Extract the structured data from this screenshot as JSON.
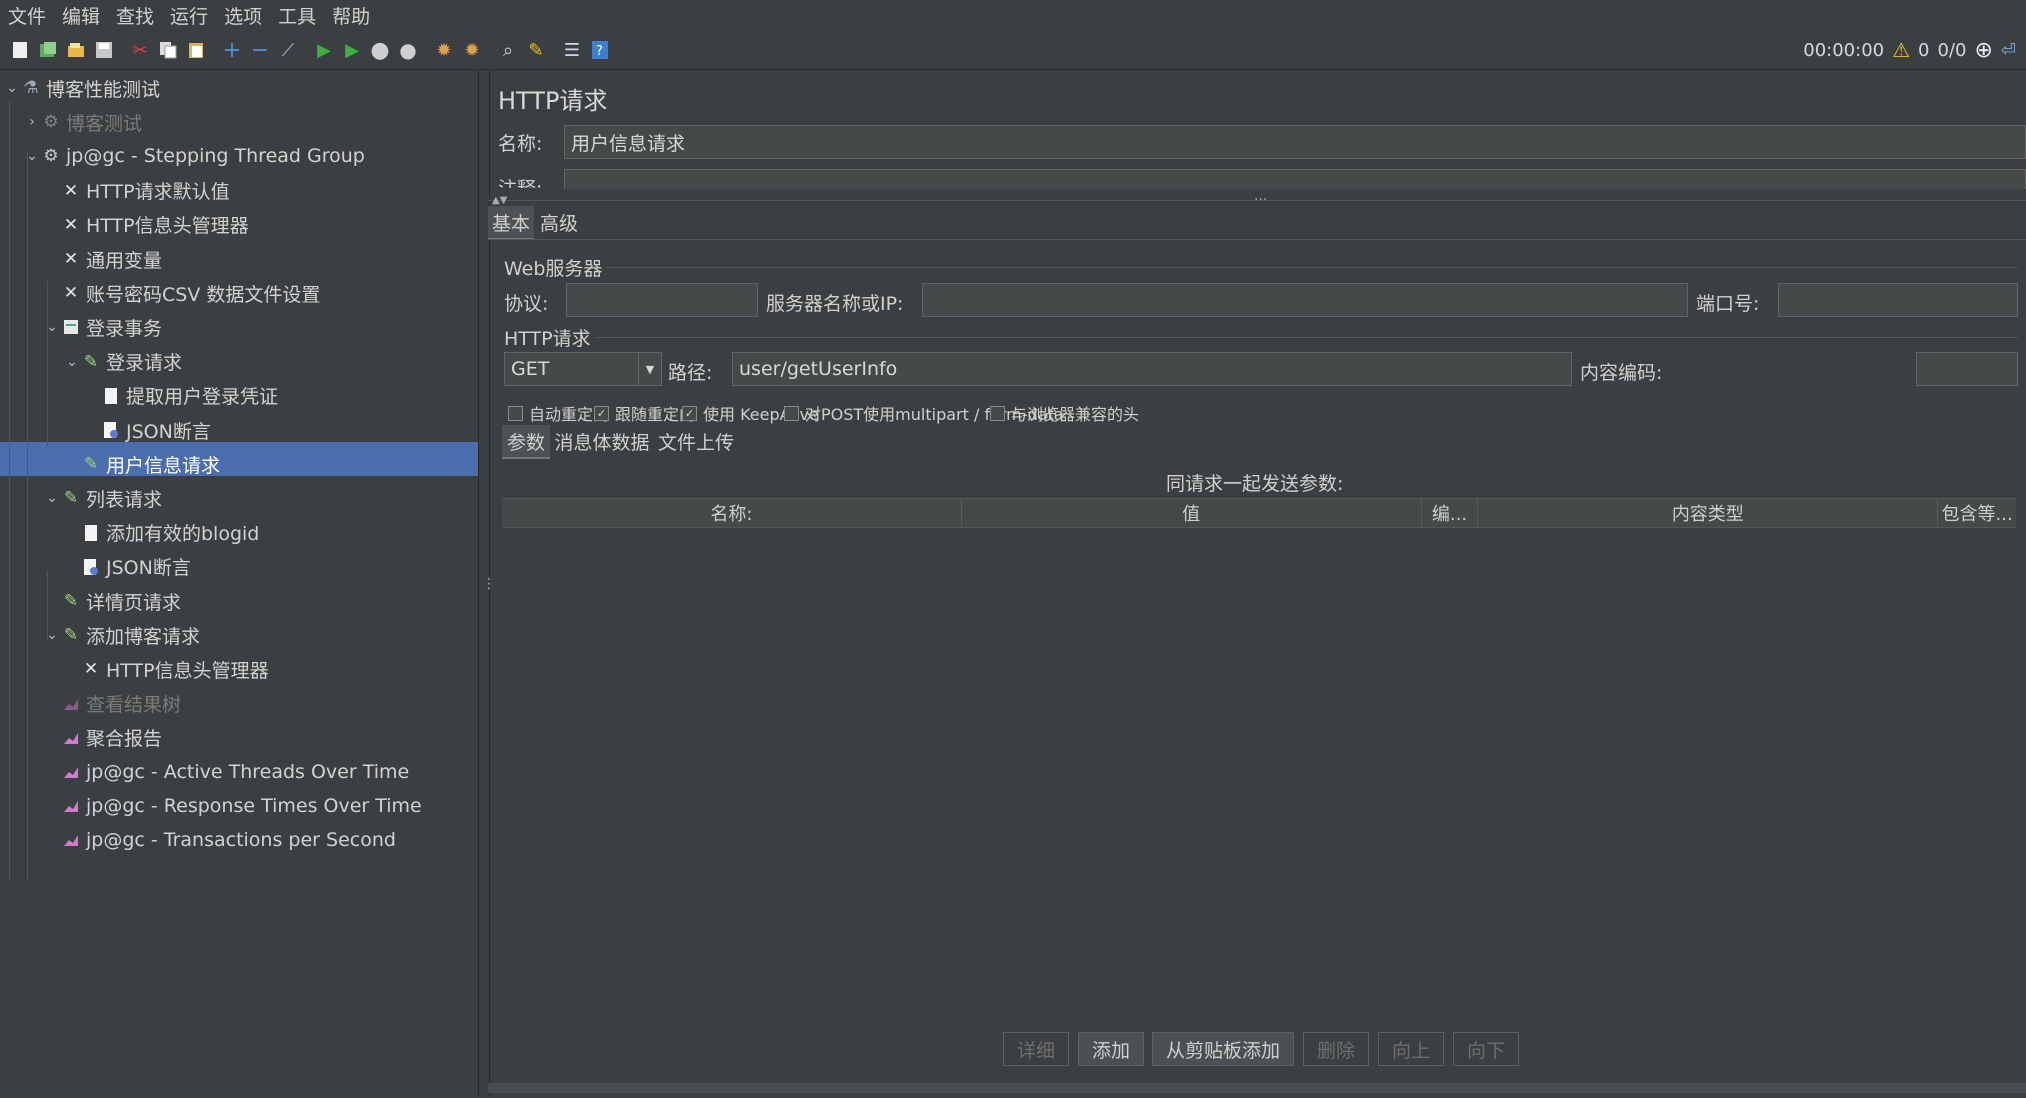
{
  "menu": [
    "文件",
    "编辑",
    "查找",
    "运行",
    "选项",
    "工具",
    "帮助"
  ],
  "toolbar": {
    "timer": "00:00:00",
    "warnings": "0",
    "threads": "0/0"
  },
  "tree": [
    {
      "label": "博客性能测试",
      "icon": "flask-icon",
      "level": 0,
      "expanded": true,
      "disabled": false
    },
    {
      "label": "博客测试",
      "icon": "gear-icon",
      "level": 1,
      "expanded": false,
      "disabled": true
    },
    {
      "label": "jp@gc - Stepping Thread Group",
      "icon": "gear-icon",
      "level": 1,
      "expanded": true,
      "disabled": false
    },
    {
      "label": "HTTP请求默认值",
      "icon": "wrench-icon",
      "level": 2,
      "disabled": false
    },
    {
      "label": "HTTP信息头管理器",
      "icon": "wrench-icon",
      "level": 2,
      "disabled": false
    },
    {
      "label": "通用变量",
      "icon": "wrench-icon",
      "level": 2,
      "disabled": false
    },
    {
      "label": "账号密码CSV 数据文件设置",
      "icon": "wrench-icon",
      "level": 2,
      "disabled": false
    },
    {
      "label": "登录事务",
      "icon": "transaction-icon",
      "level": 2,
      "expanded": true,
      "disabled": false
    },
    {
      "label": "登录请求",
      "icon": "pen-icon",
      "level": 3,
      "expanded": true,
      "disabled": false
    },
    {
      "label": "提取用户登录凭证",
      "icon": "document-icon",
      "level": 4,
      "disabled": false
    },
    {
      "label": "JSON断言",
      "icon": "assertion-icon",
      "level": 4,
      "disabled": false
    },
    {
      "label": "用户信息请求",
      "icon": "pen-icon",
      "level": 3,
      "disabled": false,
      "selected": true
    },
    {
      "label": "列表请求",
      "icon": "pen-icon",
      "level": 2,
      "expanded": true,
      "disabled": false
    },
    {
      "label": "添加有效的blogid",
      "icon": "document-icon",
      "level": 3,
      "disabled": false
    },
    {
      "label": "JSON断言",
      "icon": "assertion-icon",
      "level": 3,
      "disabled": false
    },
    {
      "label": "详情页请求",
      "icon": "pen-icon",
      "level": 2,
      "disabled": false
    },
    {
      "label": "添加博客请求",
      "icon": "pen-icon",
      "level": 2,
      "expanded": true,
      "disabled": false
    },
    {
      "label": "HTTP信息头管理器",
      "icon": "wrench-icon",
      "level": 3,
      "disabled": false
    },
    {
      "label": "查看结果树",
      "icon": "chart-icon",
      "level": 2,
      "disabled": true
    },
    {
      "label": "聚合报告",
      "icon": "chart-icon",
      "level": 2,
      "disabled": false
    },
    {
      "label": "jp@gc - Active Threads Over Time",
      "icon": "chart-icon",
      "level": 2,
      "disabled": false
    },
    {
      "label": "jp@gc - Response Times Over Time",
      "icon": "chart-icon",
      "level": 2,
      "disabled": false
    },
    {
      "label": "jp@gc - Transactions per Second",
      "icon": "chart-icon",
      "level": 2,
      "disabled": false
    }
  ],
  "panel": {
    "title": "HTTP请求",
    "name_label": "名称:",
    "name_value": "用户信息请求",
    "comment_label": "注释:",
    "tabs": [
      "基本",
      "高级"
    ],
    "web_server_legend": "Web服务器",
    "protocol_label": "协议:",
    "protocol_value": "",
    "server_label": "服务器名称或IP:",
    "server_value": "",
    "port_label": "端口号:",
    "port_value": "",
    "http_legend": "HTTP请求",
    "method": "GET",
    "path_label": "路径:",
    "path_value": "user/getUserInfo",
    "encoding_label": "内容编码:",
    "encoding_value": "",
    "checkboxes": [
      {
        "label": "自动重定向",
        "checked": false
      },
      {
        "label": "跟随重定向",
        "checked": true
      },
      {
        "label": "使用 KeepAlive",
        "checked": true
      },
      {
        "label": "对POST使用multipart / form-data",
        "checked": false
      },
      {
        "label": "与浏览器兼容的头",
        "checked": false
      }
    ],
    "subtabs": [
      "参数",
      "消息体数据",
      "文件上传"
    ],
    "params_caption": "同请求一起发送参数:",
    "columns": [
      "名称:",
      "值",
      "编...",
      "内容类型",
      "包含等..."
    ],
    "buttons": [
      "详细",
      "添加",
      "从剪贴板添加",
      "删除",
      "向上",
      "向下"
    ]
  }
}
